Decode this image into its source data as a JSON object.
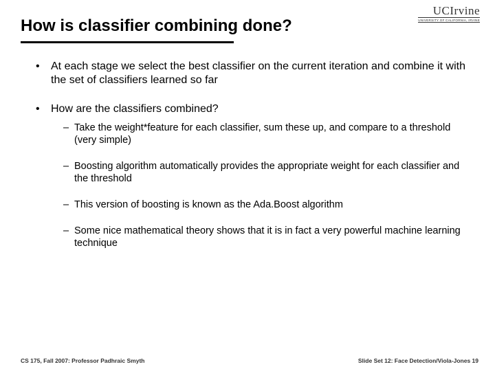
{
  "logo": {
    "main": "UCIrvine",
    "sub": "UNIVERSITY OF CALIFORNIA, IRVINE"
  },
  "title": "How is classifier combining done?",
  "bullets": [
    {
      "text": "At each stage we select the best classifier on the current iteration and combine it with the set of classifiers learned so far",
      "sub": []
    },
    {
      "text": "How are the classifiers combined?",
      "sub": [
        "Take the weight*feature for each classifier, sum these up, and compare to a threshold (very simple)",
        "Boosting algorithm automatically provides the appropriate weight for each classifier and the threshold",
        "This version of boosting is known as the Ada.Boost algorithm",
        "Some nice mathematical theory shows that it is in fact a very powerful machine learning technique"
      ]
    }
  ],
  "footer": {
    "left": "CS 175, Fall 2007: Professor Padhraic Smyth",
    "right": "Slide Set 12: Face Detection/Viola-Jones 19"
  }
}
